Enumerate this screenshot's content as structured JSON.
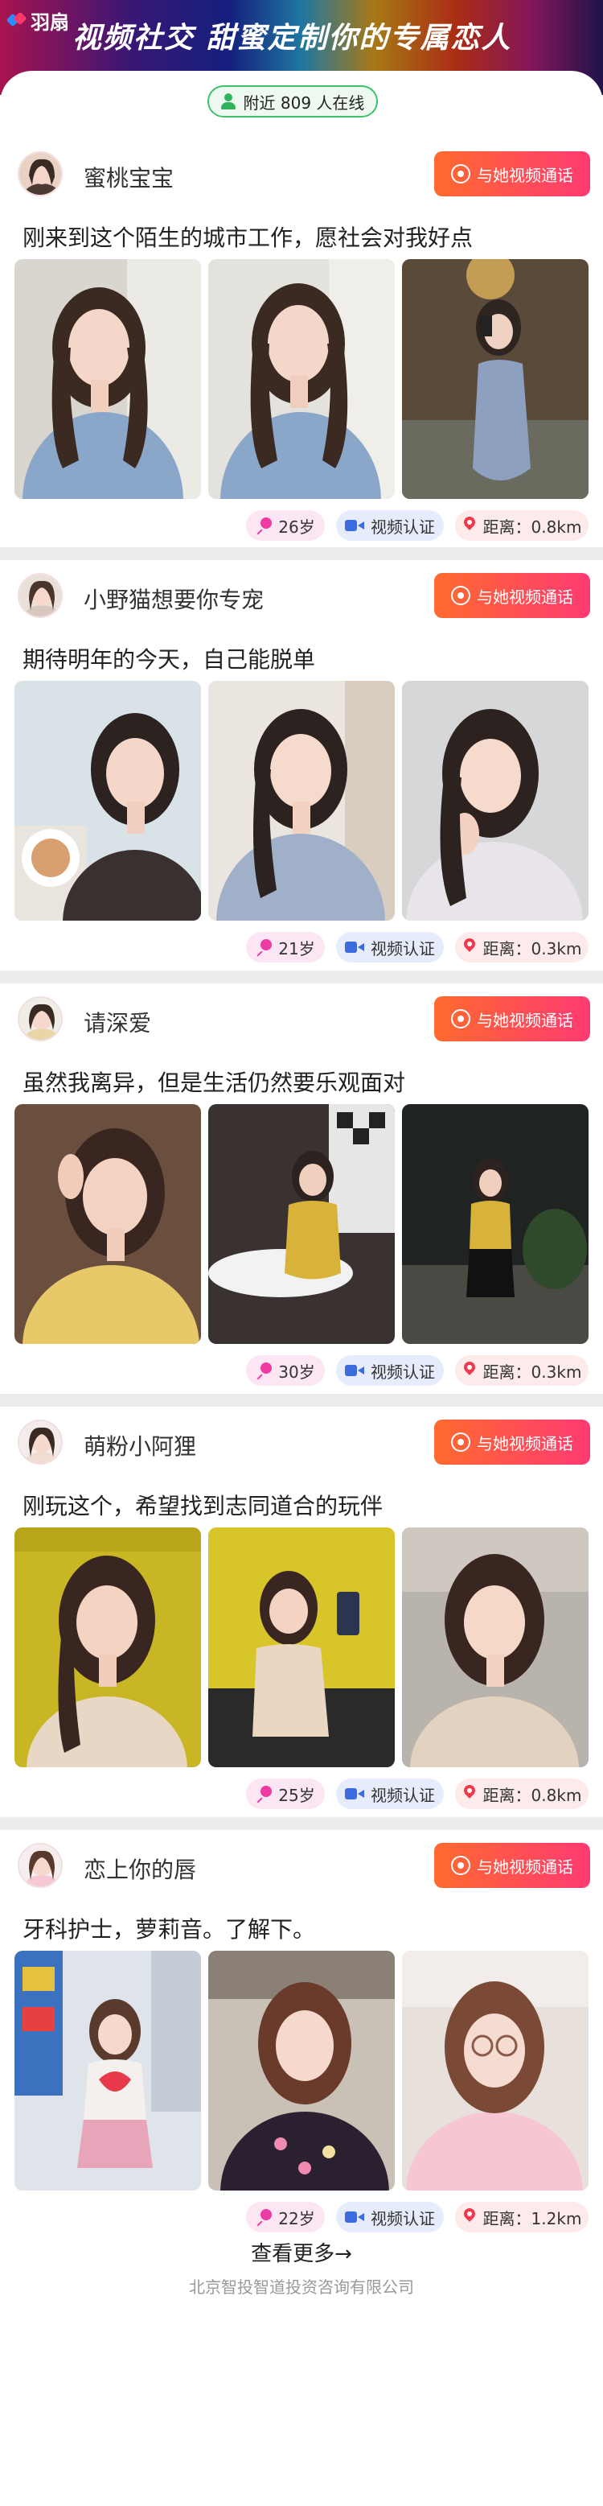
{
  "header": {
    "logo_text": "羽扇",
    "title": "视频社交 甜蜜定制你的专属恋人"
  },
  "online_badge": "附近 809 人在线",
  "profiles": [
    {
      "name": "蜜桃宝宝",
      "call_label": "与她视频通话",
      "motto": "刚来到这个陌生的城市工作，愿社会对我好点",
      "age": "26岁",
      "verify": "视频认证",
      "distance": "距离：0.8km"
    },
    {
      "name": "小野猫想要你专宠",
      "call_label": "与她视频通话",
      "motto": "期待明年的今天，自己能脱单",
      "age": "21岁",
      "verify": "视频认证",
      "distance": "距离：0.3km"
    },
    {
      "name": "请深爱",
      "call_label": "与她视频通话",
      "motto": "虽然我离异，但是生活仍然要乐观面对",
      "age": "30岁",
      "verify": "视频认证",
      "distance": "距离：0.3km"
    },
    {
      "name": "萌粉小阿狸",
      "call_label": "与她视频通话",
      "motto": "刚玩这个，希望找到志同道合的玩伴",
      "age": "25岁",
      "verify": "视频认证",
      "distance": "距离：0.8km"
    },
    {
      "name": "恋上你的唇",
      "call_label": "与她视频通话",
      "motto": "牙科护士，萝莉音。了解下。",
      "age": "22岁",
      "verify": "视频认证",
      "distance": "距离：1.2km"
    }
  ],
  "footer": {
    "more": "查看更多→",
    "company": "北京智投智道投资咨询有限公司"
  },
  "colors": {
    "call_button": "#ff4a5a",
    "online_green": "#3ec26a",
    "separator": "#ececec"
  }
}
